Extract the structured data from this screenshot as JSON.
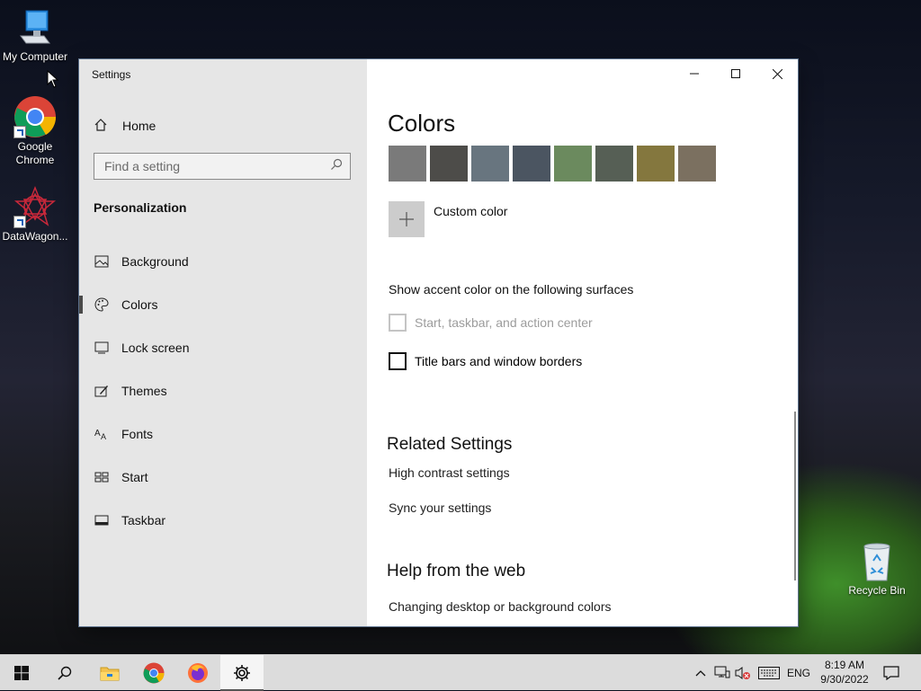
{
  "desktop": {
    "icons": [
      {
        "label": "My Computer"
      },
      {
        "label": "Google Chrome"
      },
      {
        "label": "DataWagon..."
      },
      {
        "label": "Recycle Bin"
      }
    ]
  },
  "window": {
    "title": "Settings",
    "controls": {
      "minimize": "minimize-icon",
      "maximize": "maximize-icon",
      "close": "close-icon"
    }
  },
  "sidebar": {
    "home_label": "Home",
    "search_placeholder": "Find a setting",
    "section": "Personalization",
    "items": [
      {
        "label": "Background",
        "icon": "picture-icon"
      },
      {
        "label": "Colors",
        "icon": "palette-icon",
        "active": true
      },
      {
        "label": "Lock screen",
        "icon": "lock-screen-icon"
      },
      {
        "label": "Themes",
        "icon": "themes-icon"
      },
      {
        "label": "Fonts",
        "icon": "fonts-icon"
      },
      {
        "label": "Start",
        "icon": "start-icon"
      },
      {
        "label": "Taskbar",
        "icon": "taskbar-icon"
      }
    ]
  },
  "content": {
    "heading": "Colors",
    "swatches": [
      "#7a7a7a",
      "#4d4c49",
      "#68757f",
      "#4b5561",
      "#6b8a5e",
      "#565f55",
      "#84773e",
      "#7b7060"
    ],
    "custom_color_label": "Custom color",
    "surfaces_heading": "Show accent color on the following surfaces",
    "checkbox_taskbar": "Start, taskbar, and action center",
    "checkbox_titlebars": "Title bars and window borders",
    "related_heading": "Related Settings",
    "related_links": [
      "High contrast settings",
      "Sync your settings"
    ],
    "help_heading": "Help from the web",
    "help_links": [
      "Changing desktop or background colors"
    ]
  },
  "taskbar": {
    "pinned": [
      "start-icon",
      "search-icon",
      "file-explorer-icon",
      "chrome-icon",
      "firefox-icon",
      "settings-icon"
    ],
    "language": "ENG",
    "time": "8:19 AM",
    "date": "9/30/2022"
  }
}
